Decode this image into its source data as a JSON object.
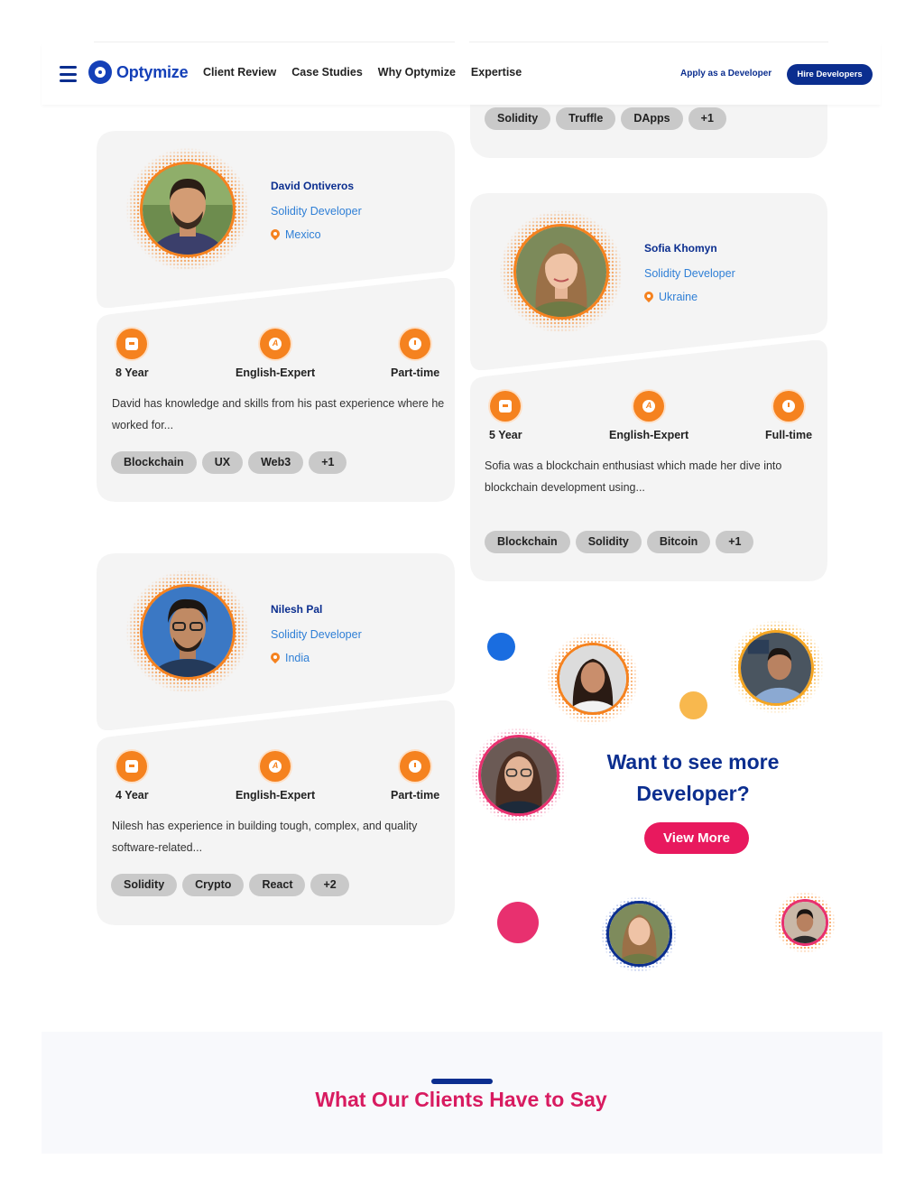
{
  "nav": {
    "logo": "Optymize",
    "links": [
      "Client Review",
      "Case Studies",
      "Why Optymize",
      "Expertise"
    ],
    "apply_label": "Apply as a Developer",
    "hire_label": "Hire Developers"
  },
  "top_partial_card": {
    "tags": [
      "Solidity",
      "Truffle",
      "DApps",
      "+1"
    ]
  },
  "developers": [
    {
      "name": "David Ontiveros",
      "role": "Solidity Developer",
      "location": "Mexico",
      "experience": "8 Year",
      "english": "English-Expert",
      "availability": "Part-time",
      "description": "David has knowledge and skills from his past experience where he worked for...",
      "tags": [
        "Blockchain",
        "UX",
        "Web3",
        "+1"
      ]
    },
    {
      "name": "Sofia Khomyn",
      "role": "Solidity Developer",
      "location": "Ukraine",
      "experience": "5 Year",
      "english": "English-Expert",
      "availability": "Full-time",
      "description": "Sofia was a blockchain enthusiast which made her dive into blockchain development using...",
      "tags": [
        "Blockchain",
        "Solidity",
        "Bitcoin",
        "+1"
      ]
    },
    {
      "name": "Nilesh Pal",
      "role": "Solidity Developer",
      "location": "India",
      "experience": "4 Year",
      "english": "English-Expert",
      "availability": "Part-time",
      "description": "Nilesh has experience in building tough, complex, and quality software-related...",
      "tags": [
        "Solidity",
        "Crypto",
        "React",
        "+2"
      ]
    }
  ],
  "cta": {
    "title_line1": "Want to see more",
    "title_line2": "Developer?",
    "button": "View More"
  },
  "clients_section": {
    "title": "What Our Clients Have to Say"
  },
  "colors": {
    "brand_blue": "#0b2e8f",
    "accent_orange": "#f5821f",
    "accent_pink": "#e8195e",
    "link_blue": "#2f7fd6"
  }
}
